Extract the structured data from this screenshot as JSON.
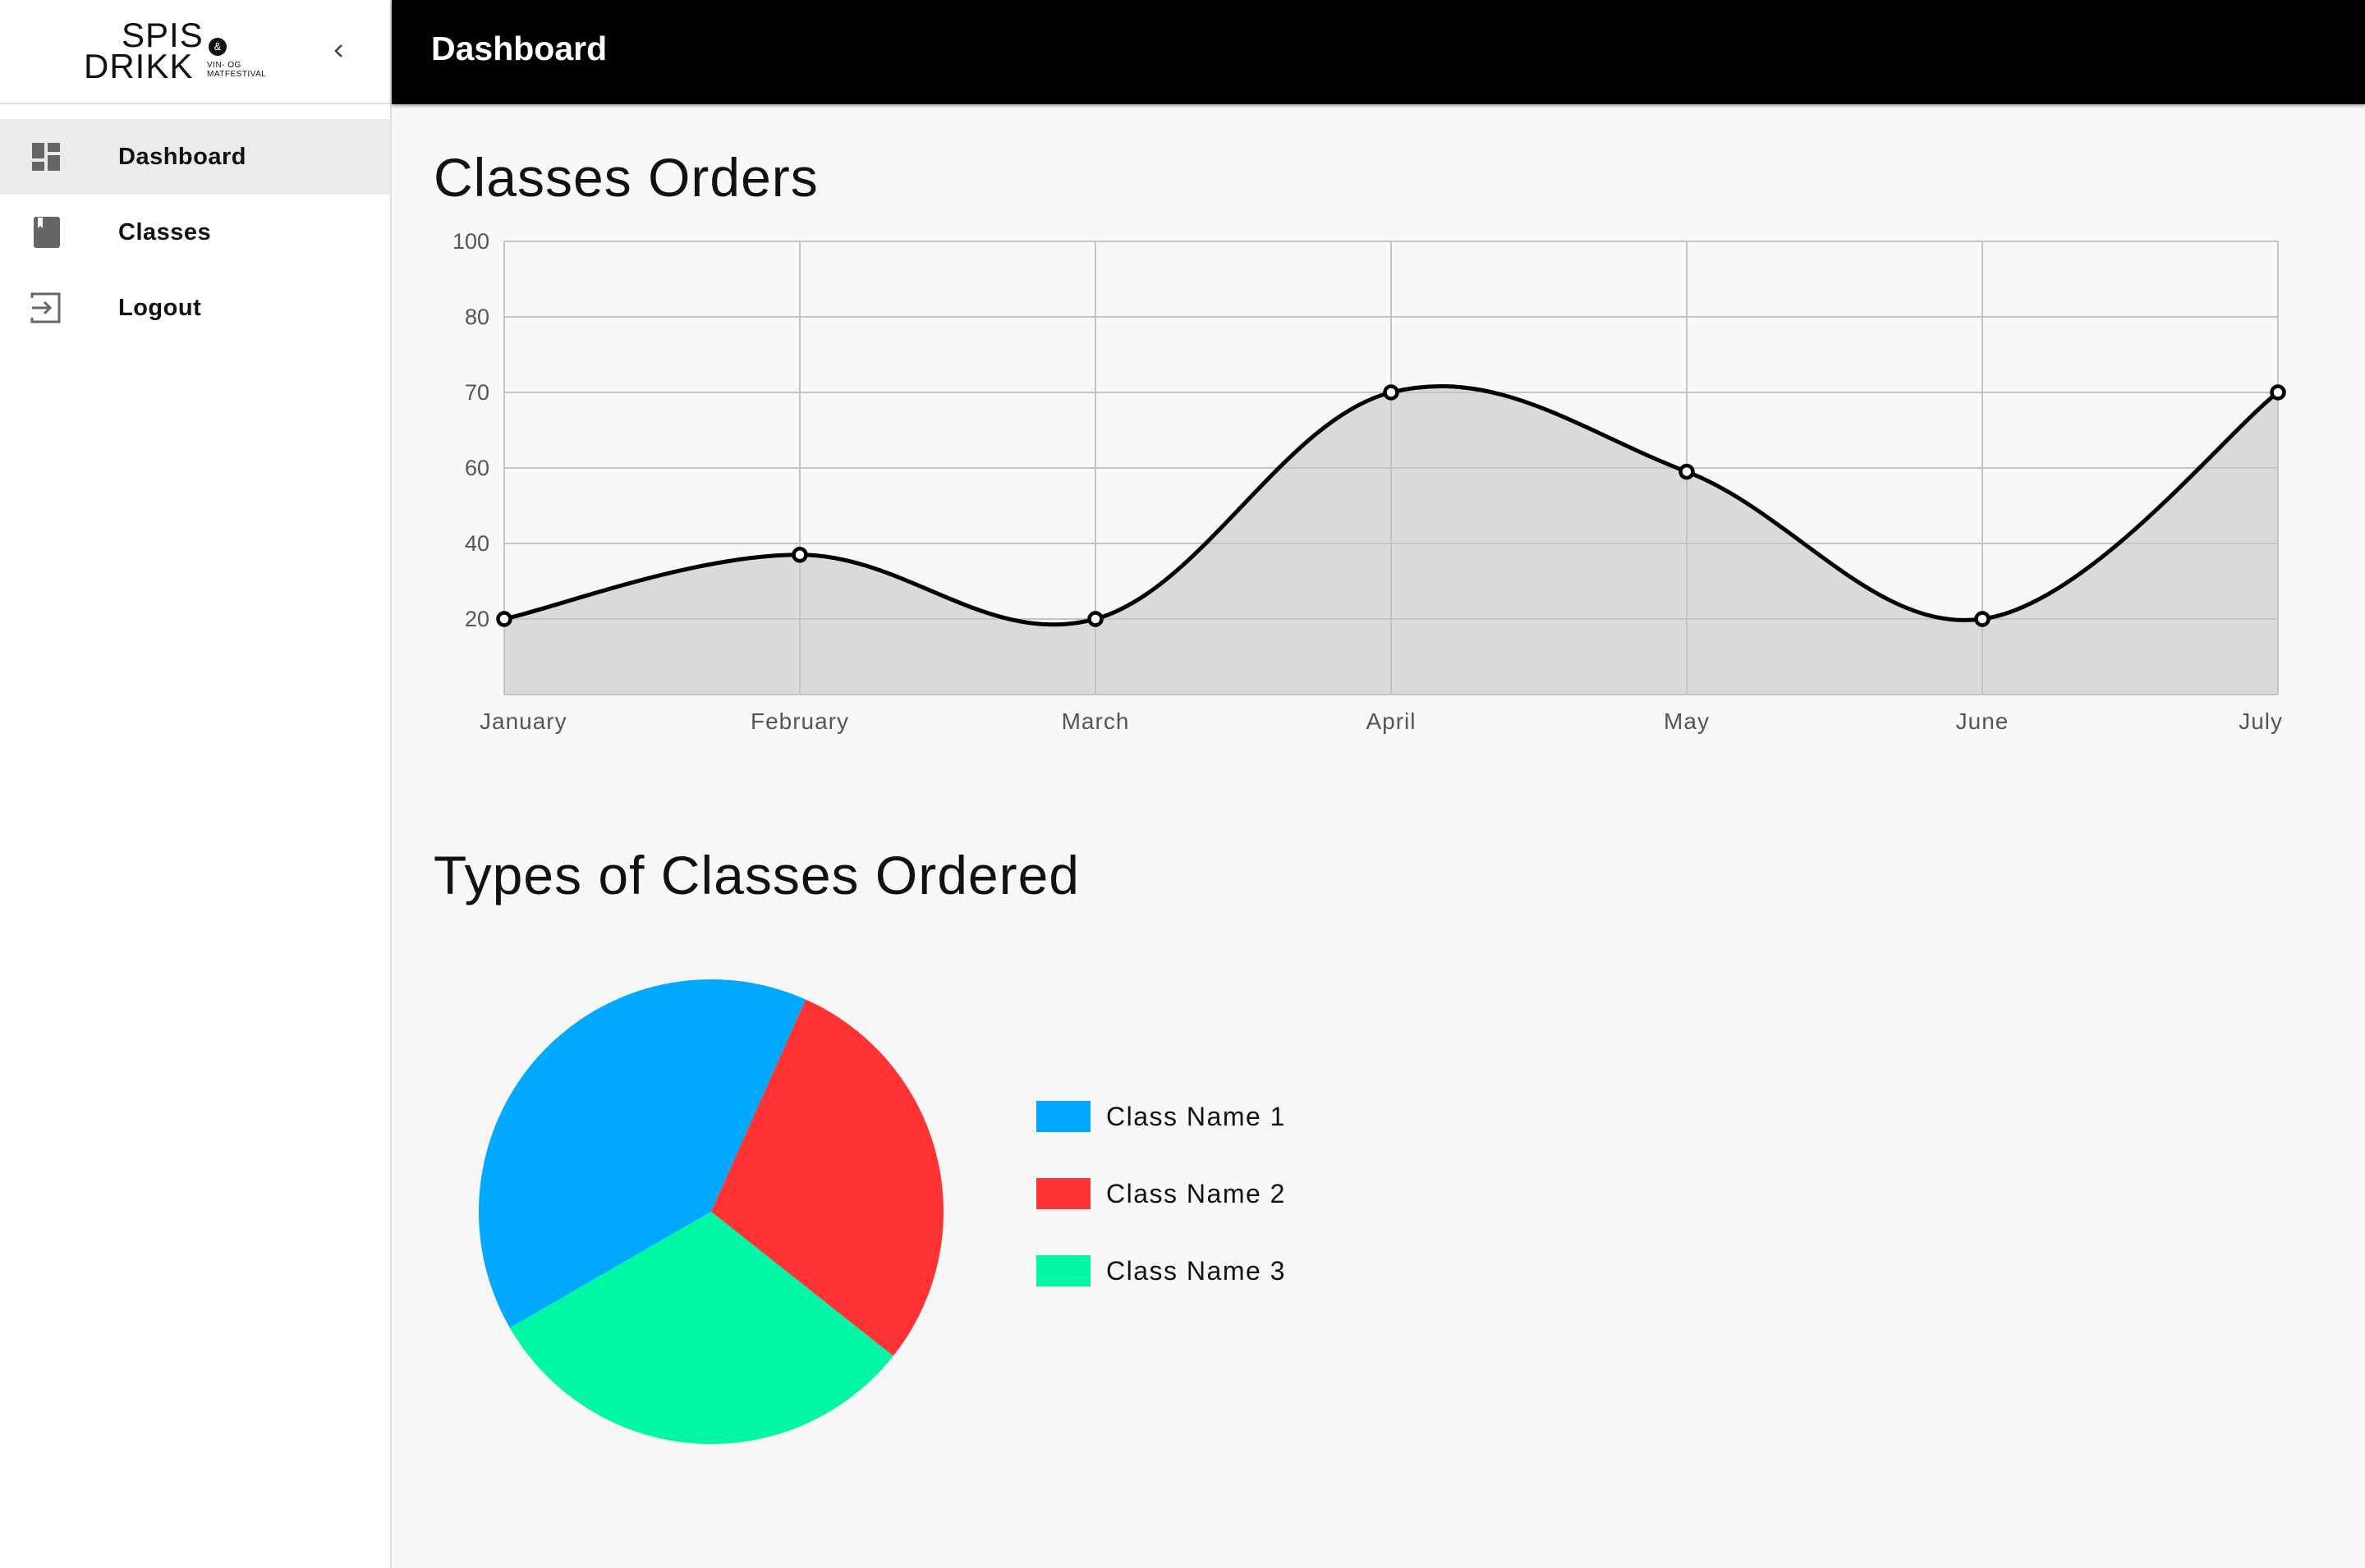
{
  "brand": {
    "line1": "SPIS",
    "line2": "DRIKK",
    "amp": "&",
    "sub1": "VIN- OG",
    "sub2": "MATFESTIVAL"
  },
  "sidebar": {
    "items": [
      {
        "label": "Dashboard",
        "icon": "dashboard-icon",
        "active": true
      },
      {
        "label": "Classes",
        "icon": "book-icon",
        "active": false
      },
      {
        "label": "Logout",
        "icon": "logout-icon",
        "active": false
      }
    ]
  },
  "topbar": {
    "title": "Dashboard"
  },
  "sections": {
    "orders_title": "Classes Orders",
    "types_title": "Types of Classes Ordered"
  },
  "colors": {
    "class1": "#00a8ff",
    "class2": "#ff3333",
    "class3": "#00f7a5",
    "area_fill": "#dadada",
    "line": "#000000"
  },
  "chart_data": [
    {
      "type": "line",
      "title": "Classes Orders",
      "categories": [
        "January",
        "February",
        "March",
        "April",
        "May",
        "June",
        "July"
      ],
      "series": [
        {
          "values": [
            20,
            37,
            20,
            70,
            59,
            20,
            70
          ]
        }
      ],
      "y_ticks": [
        "100",
        "80",
        "70",
        "60",
        "40",
        "20"
      ],
      "area_fill": true,
      "smooth": true,
      "grid": true,
      "legend": "none"
    },
    {
      "type": "pie",
      "title": "Types of Classes Ordered",
      "labels": [
        "Class Name 1",
        "Class Name 2",
        "Class Name 3"
      ],
      "values": [
        40,
        29,
        31
      ],
      "colors": [
        "#00a8ff",
        "#ff3333",
        "#00f7a5"
      ],
      "legend": "right"
    }
  ]
}
